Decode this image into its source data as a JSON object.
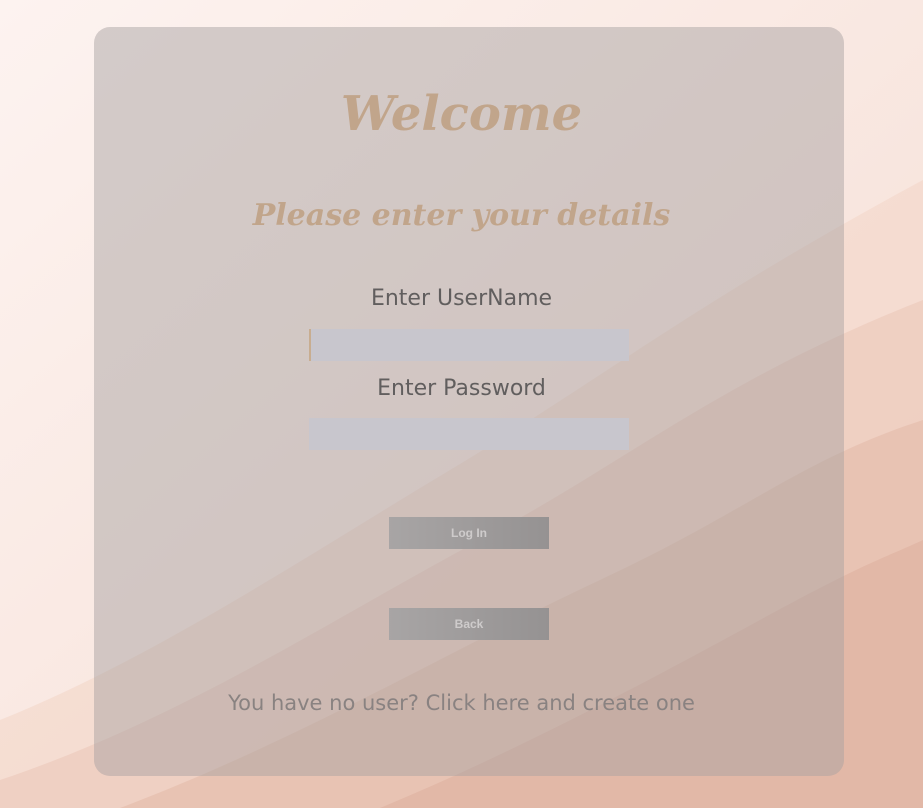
{
  "colors": {
    "page_background": "#fbeee9",
    "card_overlay": "#a8a0a0",
    "heading_accent": "#d9a977",
    "input_background": "#e7e8f6",
    "button_gradient_start": "#a9a9a9",
    "button_gradient_end": "#858585"
  },
  "form": {
    "title": "Welcome",
    "subtitle": "Please enter your details",
    "username_label": "Enter UserName",
    "username_value": "",
    "password_label": "Enter Password",
    "password_value": "",
    "login_button": "Log In",
    "back_button": "Back",
    "register_link": "You have no user? Click here and create one"
  }
}
